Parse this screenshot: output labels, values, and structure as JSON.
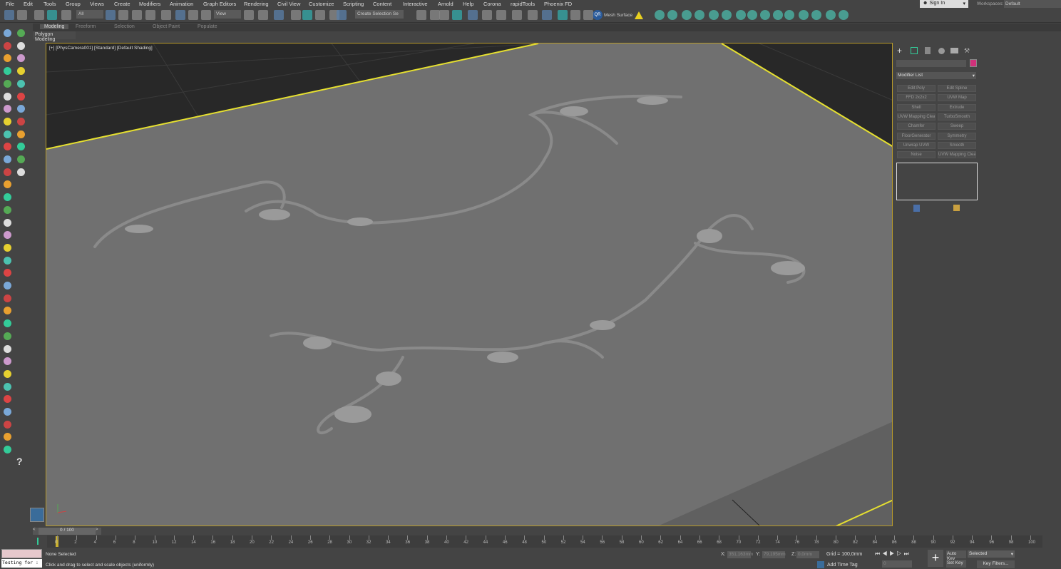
{
  "menu": [
    "File",
    "Edit",
    "Tools",
    "Group",
    "Views",
    "Create",
    "Modifiers",
    "Animation",
    "Graph Editors",
    "Rendering",
    "Civil View",
    "Customize",
    "Scripting",
    "Content",
    "Interactive",
    "Arnold",
    "Help",
    "Corona",
    "rapidTools",
    "Phoenix FD"
  ],
  "account": {
    "sign_in": "Sign In",
    "workspaces_label": "Workspaces:",
    "workspace": "Default"
  },
  "toolbar": {
    "selection_filter": "All",
    "ref_coord": "View",
    "named_selection": "Create Selection Se",
    "mesh_surface": "Mesh Surface",
    "qr_label": "QR"
  },
  "ribbon": {
    "tabs": [
      "Modeling",
      "Freeform",
      "Selection",
      "Object Paint",
      "Populate"
    ],
    "active": "Modeling",
    "sub": "Polygon Modeling"
  },
  "viewport": {
    "label": "[+] [PhysCamera001] [Standard] [Default Shading]"
  },
  "command_panel": {
    "modifier_list": "Modifier List",
    "color": "#d0307a",
    "buttons": [
      "Edit Poly",
      "Edit Spline",
      "FFD 2x2x2",
      "UVW Map",
      "Shell",
      "Extrude",
      "UVW Mapping Clear",
      "TurboSmooth",
      "Chamfer",
      "Sweep",
      "FloorGenerator",
      "Symmetry",
      "Unwrap UVW",
      "Smooth",
      "Noise",
      "UVW Mapping Clear"
    ]
  },
  "timeline": {
    "frame": "0 / 100",
    "ticks": [
      0,
      2,
      4,
      6,
      8,
      10,
      12,
      14,
      16,
      18,
      20,
      22,
      24,
      26,
      28,
      30,
      32,
      34,
      36,
      38,
      40,
      42,
      44,
      46,
      48,
      50,
      52,
      54,
      56,
      58,
      60,
      62,
      64,
      66,
      68,
      70,
      72,
      74,
      76,
      78,
      80,
      82,
      84,
      86,
      88,
      90,
      92,
      94,
      96,
      98,
      100
    ]
  },
  "status": {
    "selection": "None Selected",
    "prompt": "Click and drag to select and scale objects (uniformly)",
    "script": "Testing for :",
    "x_label": "X:",
    "x": "351,163mm",
    "y_label": "Y:",
    "y": "79,195mm",
    "z_label": "Z:",
    "z": "0,0mm",
    "grid": "Grid = 100,0mm",
    "add_time_tag": "Add Time Tag",
    "frame_field": "0",
    "auto_key": "Auto Key",
    "set_key": "Set Key",
    "key_mode": "Selected",
    "key_filters": "Key Filters..."
  }
}
